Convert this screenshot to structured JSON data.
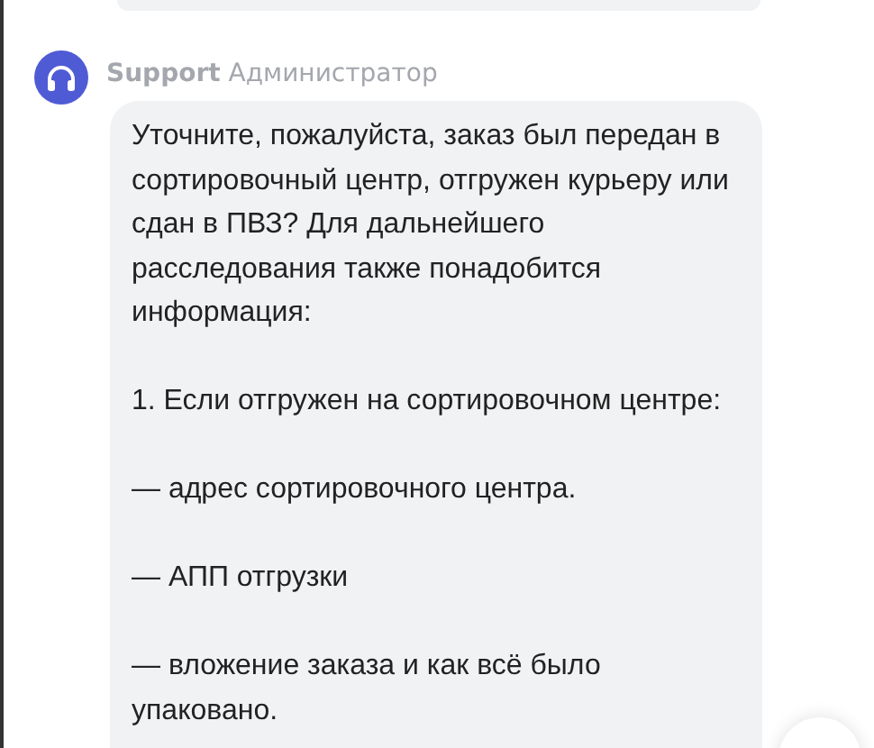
{
  "message": {
    "author": "Support",
    "role": "Администратор",
    "paragraphs": [
      "Уточните, пожалуйста, заказ был передан в сортировочный центр, отгружен курьеру или сдан в ПВЗ? Для дальнейшего расследования также понадобится информация:",
      "1. Если отгружен на сортировочном центре:",
      "— адрес сортировочного центра.",
      "— АПП отгрузки",
      "— вложение заказа и как всё было упаковано."
    ]
  }
}
